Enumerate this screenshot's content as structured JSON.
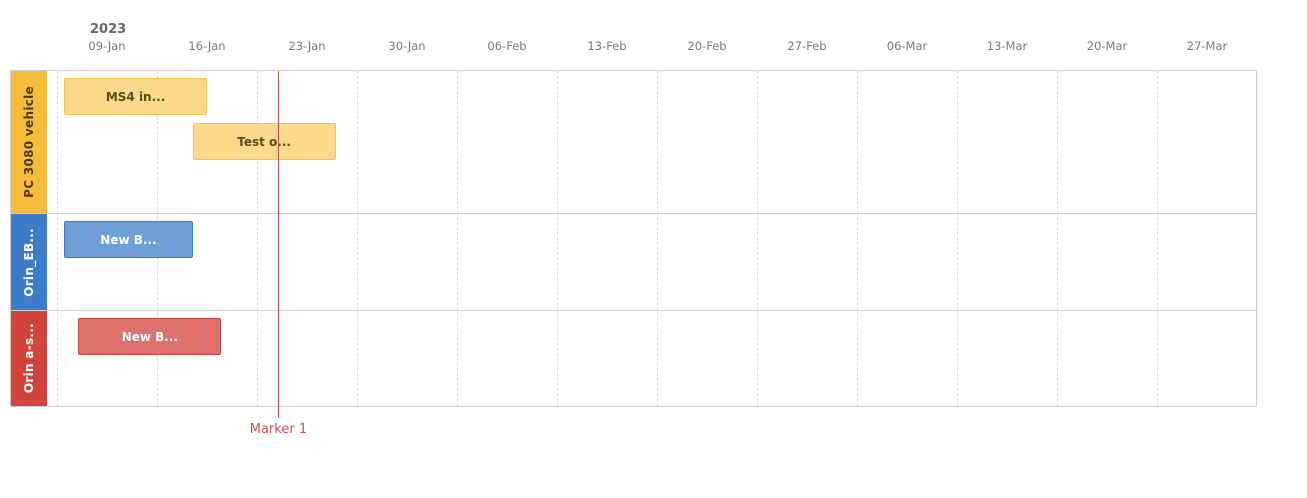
{
  "chart_data": {
    "type": "gantt",
    "year": "2023",
    "x_ticks": [
      "09-Jan",
      "16-Jan",
      "23-Jan",
      "30-Jan",
      "06-Feb",
      "13-Feb",
      "20-Feb",
      "27-Feb",
      "06-Mar",
      "13-Mar",
      "20-Mar",
      "27-Mar"
    ],
    "lanes": [
      {
        "label": "PC 3080 vehicle",
        "color": "#f6bd3a",
        "task_fill": "#fad98a",
        "task_border": "#f3c355",
        "task_text": "#5a4a1f",
        "tasks": [
          {
            "label": "MS4 in...",
            "start": "2023-01-06",
            "end": "2023-01-16",
            "track": 0
          },
          {
            "label": "Test o...",
            "start": "2023-01-15",
            "end": "2023-01-25",
            "track": 1
          }
        ]
      },
      {
        "label": "Orin_EB...",
        "color": "#3d7cc9",
        "task_fill": "#6ea0d8",
        "task_border": "#3d7cc9",
        "task_text": "#ffffff",
        "tasks": [
          {
            "label": "New B...",
            "start": "2023-01-06",
            "end": "2023-01-15",
            "track": 0
          }
        ]
      },
      {
        "label": "Orin a-s...",
        "color": "#d1433b",
        "task_fill": "#dd716c",
        "task_border": "#c8413a",
        "task_text": "#ffffff",
        "tasks": [
          {
            "label": "New B...",
            "start": "2023-01-07",
            "end": "2023-01-17",
            "track": 0
          }
        ]
      }
    ],
    "markers": [
      {
        "label": "Marker 1",
        "date": "2023-01-21",
        "color": "#d35450"
      }
    ]
  }
}
